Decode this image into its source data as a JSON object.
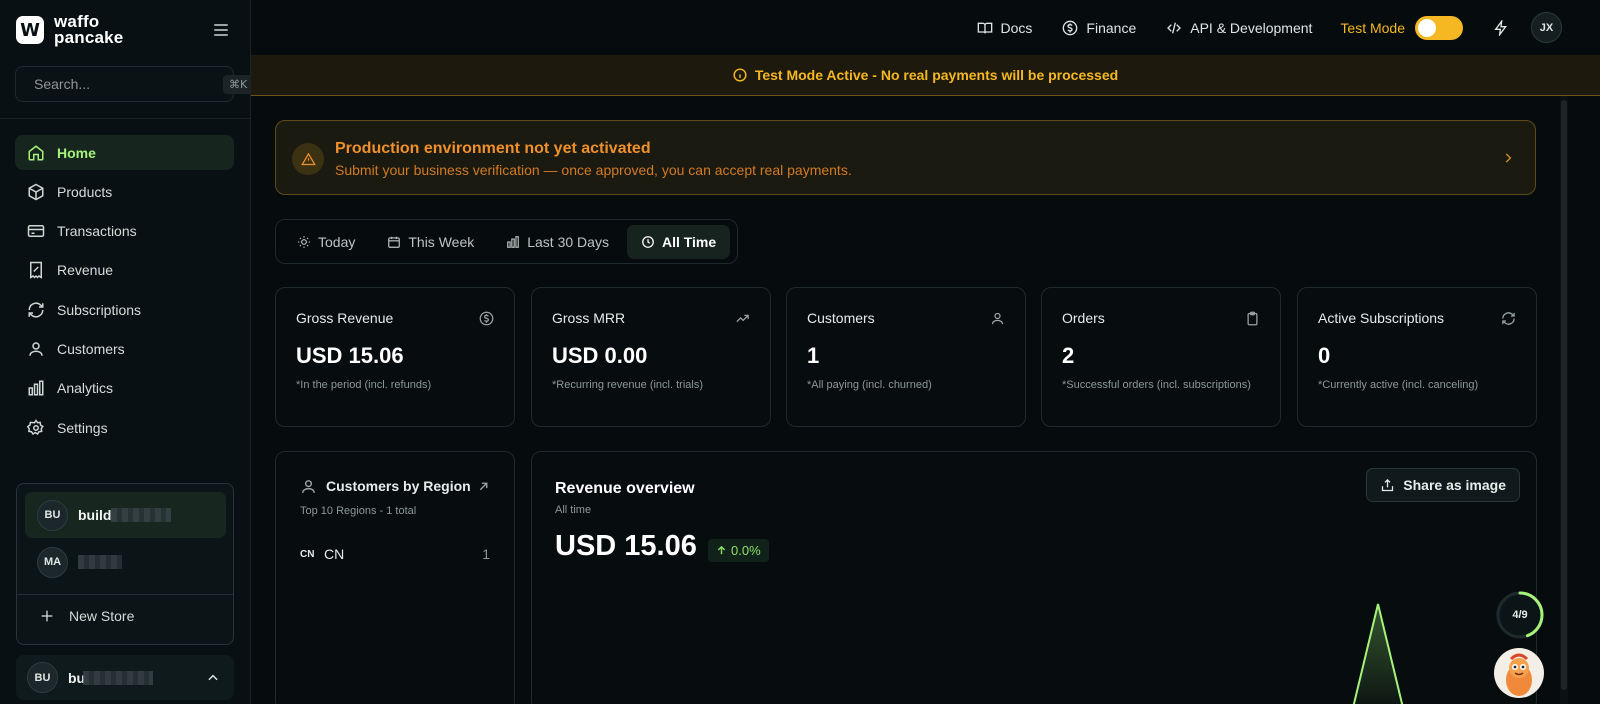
{
  "brand": {
    "line1": "waffo",
    "line2": "pancake",
    "mark": "W"
  },
  "search": {
    "placeholder": "Search...",
    "shortcut": "⌘K"
  },
  "nav": [
    {
      "label": "Home",
      "icon": "home-icon",
      "active": true
    },
    {
      "label": "Products",
      "icon": "box-icon"
    },
    {
      "label": "Transactions",
      "icon": "credit-card-icon"
    },
    {
      "label": "Revenue",
      "icon": "receipt-icon"
    },
    {
      "label": "Subscriptions",
      "icon": "refresh-icon"
    },
    {
      "label": "Customers",
      "icon": "user-icon"
    },
    {
      "label": "Analytics",
      "icon": "bar-chart-icon"
    },
    {
      "label": "Settings",
      "icon": "gear-icon"
    }
  ],
  "stores": {
    "items": [
      {
        "initials": "BU",
        "name": "build",
        "active": true
      },
      {
        "initials": "MA",
        "name": ""
      }
    ],
    "new_store_label": "New Store"
  },
  "user": {
    "initials": "BU",
    "name": "bu"
  },
  "topbar": {
    "docs": "Docs",
    "finance": "Finance",
    "api": "API & Development",
    "test_mode": "Test Mode",
    "test_mode_on": true,
    "avatar": "JX"
  },
  "test_banner": "Test Mode Active - No real payments will be processed",
  "prod_banner": {
    "title": "Production environment not yet activated",
    "subtitle": "Submit your business verification — once approved, you can accept real payments."
  },
  "periods": [
    {
      "label": "Today",
      "icon": "sun-icon"
    },
    {
      "label": "This Week",
      "icon": "calendar-icon"
    },
    {
      "label": "Last 30 Days",
      "icon": "bar-chart-icon"
    },
    {
      "label": "All Time",
      "icon": "clock-icon",
      "active": true
    }
  ],
  "stats": [
    {
      "label": "Gross Revenue",
      "value": "USD 15.06",
      "note": "*In the period (incl. refunds)",
      "icon": "dollar-circle-icon"
    },
    {
      "label": "Gross MRR",
      "value": "USD 0.00",
      "note": "*Recurring revenue (incl. trials)",
      "icon": "trend-up-icon"
    },
    {
      "label": "Customers",
      "value": "1",
      "note": "*All paying (incl. churned)",
      "icon": "user-icon"
    },
    {
      "label": "Orders",
      "value": "2",
      "note": "*Successful orders (incl. subscriptions)",
      "icon": "clipboard-icon"
    },
    {
      "label": "Active Subscriptions",
      "value": "0",
      "note": "*Currently active (incl. canceling)",
      "icon": "refresh-icon"
    }
  ],
  "regions": {
    "title": "Customers by Region",
    "subtitle": "Top 10 Regions - 1 total",
    "rows": [
      {
        "code": "CN",
        "name": "CN",
        "count": "1"
      }
    ]
  },
  "revenue": {
    "title": "Revenue overview",
    "subtitle": "All time",
    "value": "USD 15.06",
    "change": "0.0%",
    "share_label": "Share as image"
  },
  "onboarding": {
    "progress": "4/9",
    "done": 4,
    "total": 9
  },
  "colors": {
    "accent": "#a6f27a",
    "warning": "#f5b722",
    "orange": "#f0902a"
  }
}
